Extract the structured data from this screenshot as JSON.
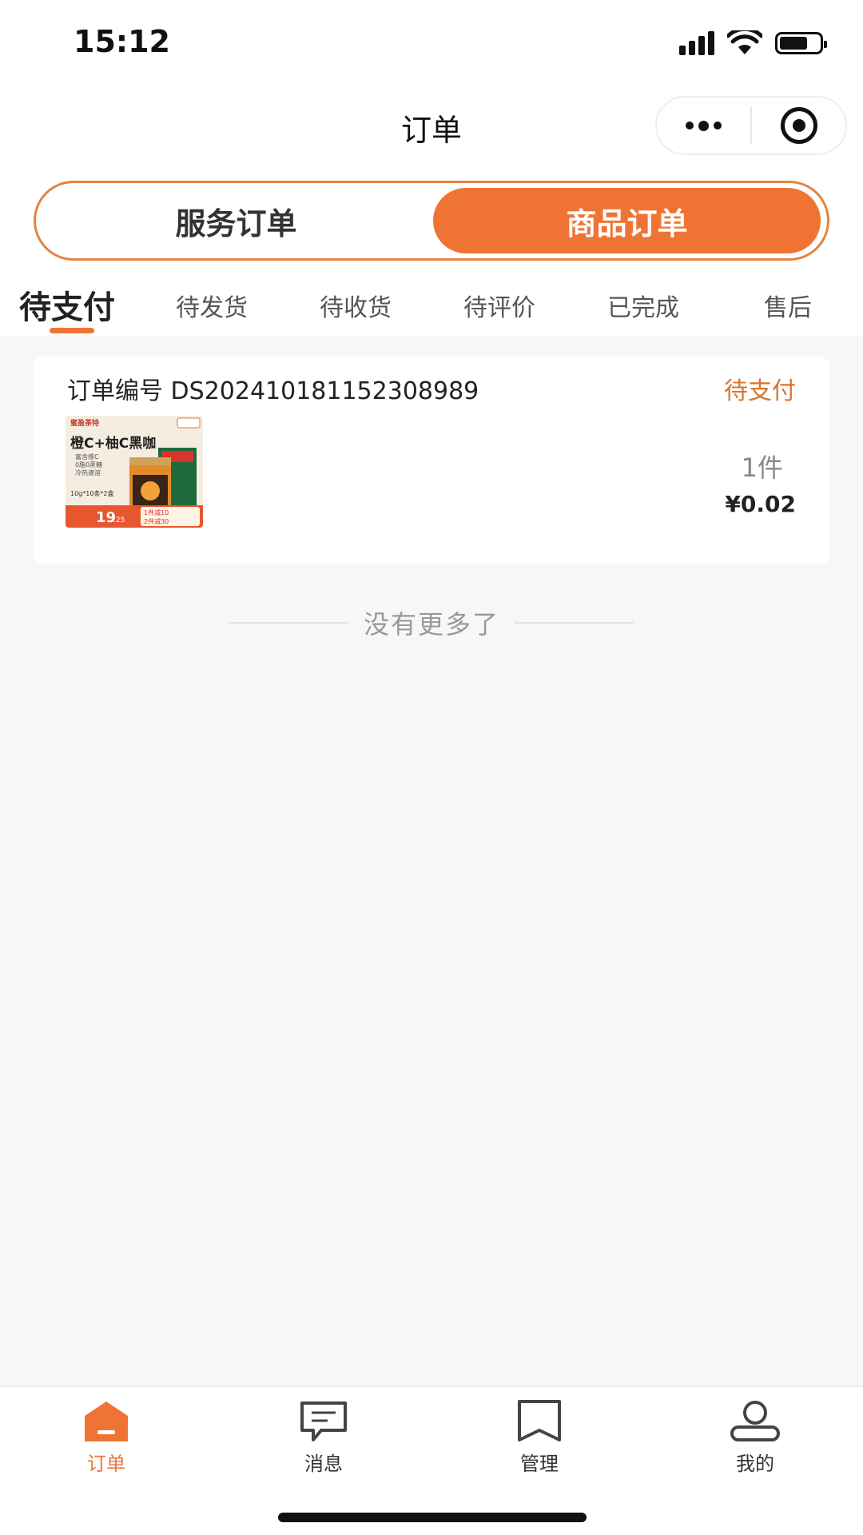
{
  "status_bar": {
    "time": "15:12"
  },
  "nav": {
    "title": "订单"
  },
  "segment": {
    "left_label": "服务订单",
    "right_label": "商品订单",
    "selected": "商品订单"
  },
  "status_tabs": [
    "待支付",
    "待发货",
    "待收货",
    "待评价",
    "已完成",
    "售后"
  ],
  "active_status_tab": "待支付",
  "order": {
    "number_label": "订单编号",
    "number": "DS20241018115230898​9",
    "status": "待支付",
    "quantity": "1件",
    "price": "¥0.02",
    "product_image": {
      "brand": "蜜盈茶特",
      "headline": "橙C+柚C黑咖",
      "features": [
        "富含维C",
        "0脂0蔗糖",
        "冷热速溶"
      ],
      "spec": "10g*10条*2盒",
      "price_big": "19",
      "price_small": ".25",
      "promo": [
        "1件减10",
        "2件减30"
      ]
    }
  },
  "list_end_text": "没有更多了",
  "tabbar": {
    "items": [
      {
        "label": "订单",
        "icon": "order-icon",
        "active": true
      },
      {
        "label": "消息",
        "icon": "message-icon",
        "active": false
      },
      {
        "label": "管理",
        "icon": "manage-icon",
        "active": false
      },
      {
        "label": "我的",
        "icon": "profile-icon",
        "active": false
      }
    ]
  },
  "colors": {
    "accent": "#ef7434",
    "status_text": "#d8732f",
    "background": "#f7f7f7"
  }
}
